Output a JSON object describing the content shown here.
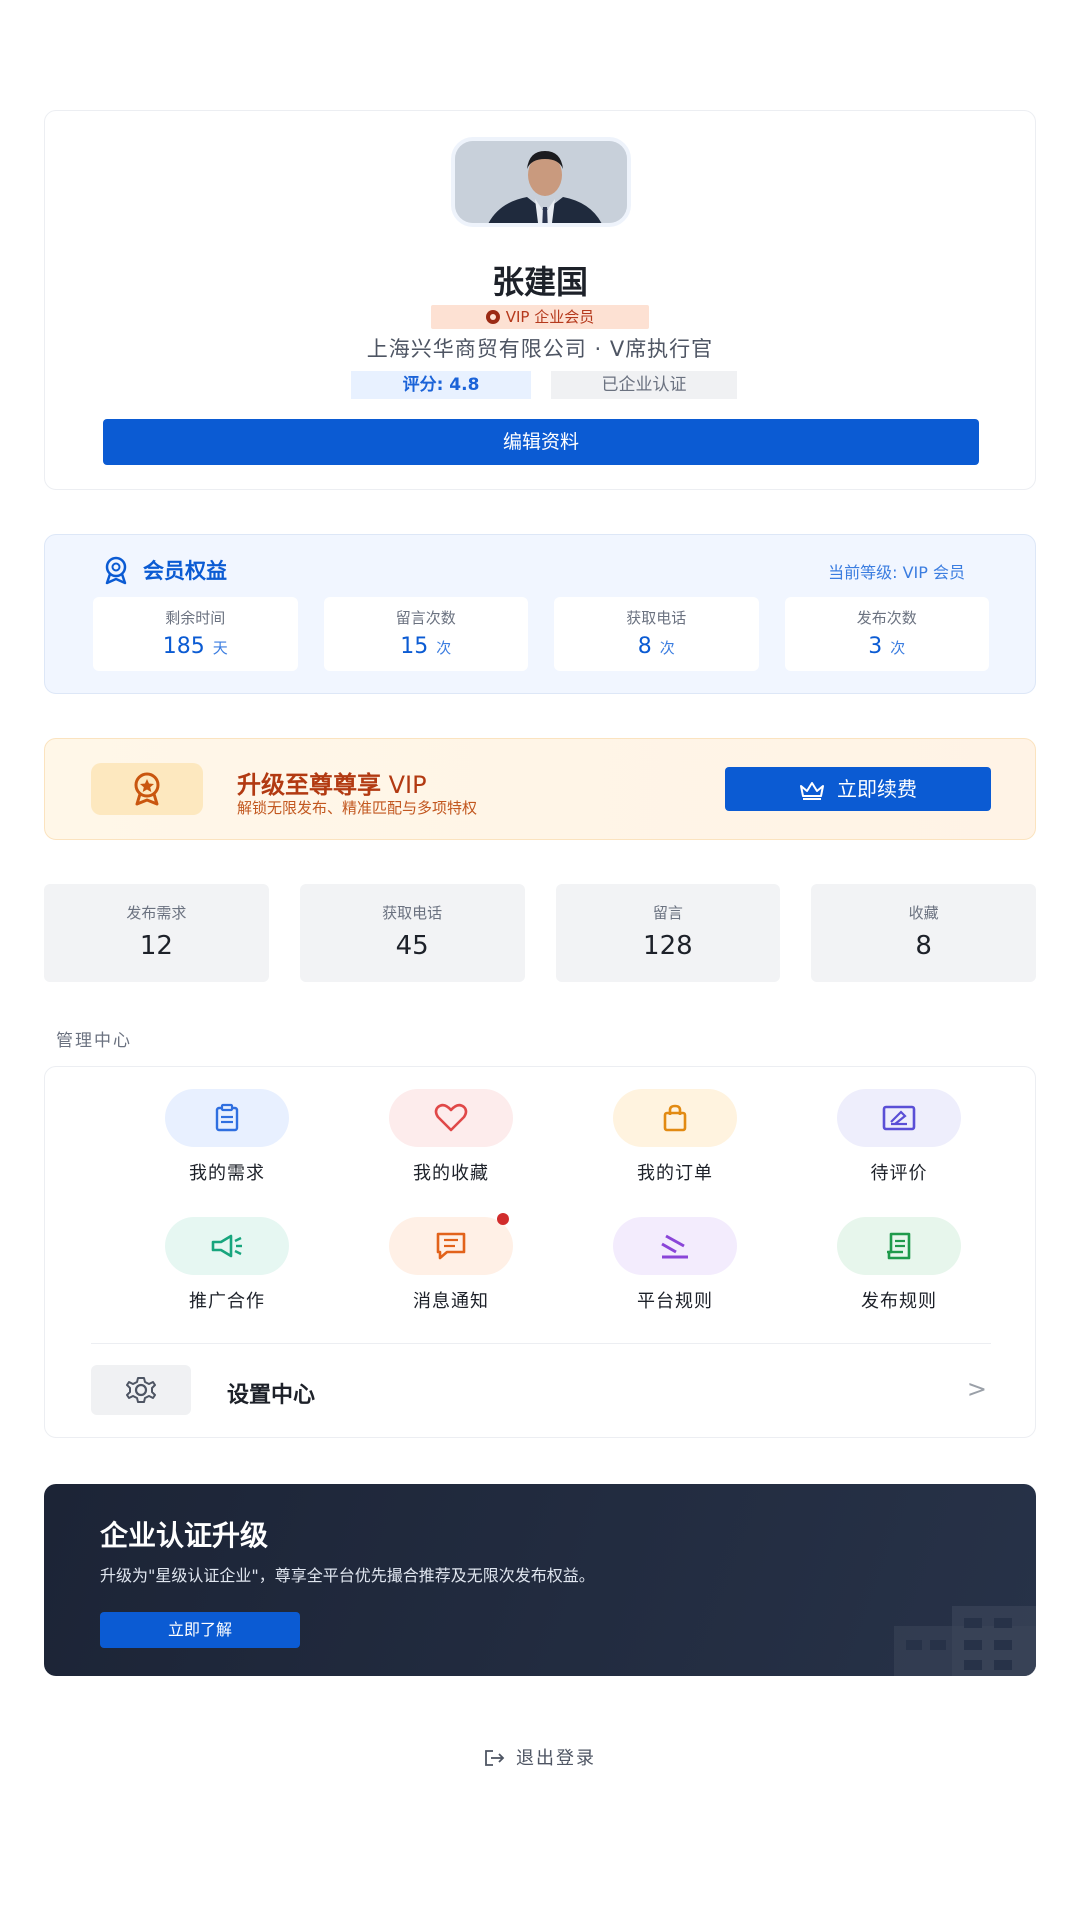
{
  "profile": {
    "name": "张建国",
    "vip_badge": "VIP 企业会员",
    "company": "上海兴华商贸有限公司 · V席执行官",
    "score": "评分: 4.8",
    "certified": "已企业认证",
    "edit_label": "编辑资料"
  },
  "membership": {
    "title": "会员权益",
    "level": "当前等级: VIP 会员",
    "stats": [
      {
        "label": "剩余时间",
        "value": "185",
        "unit": "天"
      },
      {
        "label": "留言次数",
        "value": "15",
        "unit": "次"
      },
      {
        "label": "获取电话",
        "value": "8",
        "unit": "次"
      },
      {
        "label": "发布次数",
        "value": "3",
        "unit": "次"
      }
    ]
  },
  "upgrade": {
    "title_bold": "升级至尊尊享",
    "title_rest": " VIP",
    "subtitle": "解锁无限发布、精准匹配与多项特权",
    "button": "立即续费"
  },
  "stats": [
    {
      "label": "发布需求",
      "value": "12"
    },
    {
      "label": "获取电话",
      "value": "45"
    },
    {
      "label": "留言",
      "value": "128"
    },
    {
      "label": "收藏",
      "value": "8"
    }
  ],
  "management": {
    "title": "管理中心",
    "items": [
      {
        "label": "我的需求",
        "icon": "clipboard-icon",
        "bg": "#e8f0ff",
        "color": "#2f6fe0"
      },
      {
        "label": "我的收藏",
        "icon": "heart-icon",
        "bg": "#fdecec",
        "color": "#e04848"
      },
      {
        "label": "我的订单",
        "icon": "bag-icon",
        "bg": "#fff3df",
        "color": "#e28a12"
      },
      {
        "label": "待评价",
        "icon": "edit-card-icon",
        "bg": "#eeeefc",
        "color": "#5a4fd6"
      },
      {
        "label": "推广合作",
        "icon": "megaphone-icon",
        "bg": "#e6f7f2",
        "color": "#17a57d"
      },
      {
        "label": "消息通知",
        "icon": "message-icon",
        "bg": "#fff0e6",
        "color": "#e2621a"
      },
      {
        "label": "平台规则",
        "icon": "gavel-icon",
        "bg": "#f3ecfd",
        "color": "#8a45d8"
      },
      {
        "label": "发布规则",
        "icon": "document-icon",
        "bg": "#e7f6ec",
        "color": "#1f9a4b"
      }
    ],
    "settings_label": "设置中心",
    "chevron": ">"
  },
  "enterprise": {
    "title": "企业认证升级",
    "desc": "升级为\"星级认证企业\"，尊享全平台优先撮合推荐及无限次发布权益。",
    "button": "立即了解"
  },
  "logout": "退出登录",
  "colors": {
    "primary": "#0b5bd3",
    "upgrade_text": "#b23a12",
    "enterprise_bg": "#1c2436"
  }
}
